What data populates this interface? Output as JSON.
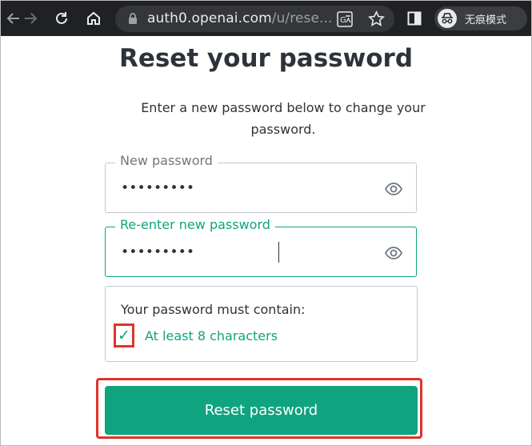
{
  "browser": {
    "url_host": "auth0.openai.com",
    "url_path": "/u/rese...",
    "incognito_label": "无痕模式"
  },
  "page": {
    "title": "Reset your password",
    "subtitle": "Enter a new password below to change your password.",
    "new_password": {
      "label": "New password",
      "value": "•••••••••"
    },
    "reenter_password": {
      "label": "Re-enter new password",
      "value": "•••••••••"
    },
    "requirements": {
      "heading": "Your password must contain:",
      "items": [
        {
          "text": "At least 8 characters",
          "check": "✓",
          "satisfied": true
        }
      ]
    },
    "submit_label": "Reset password"
  },
  "colors": {
    "accent": "#10a37f",
    "highlight": "#e0332a",
    "toolbar": "#202124"
  }
}
